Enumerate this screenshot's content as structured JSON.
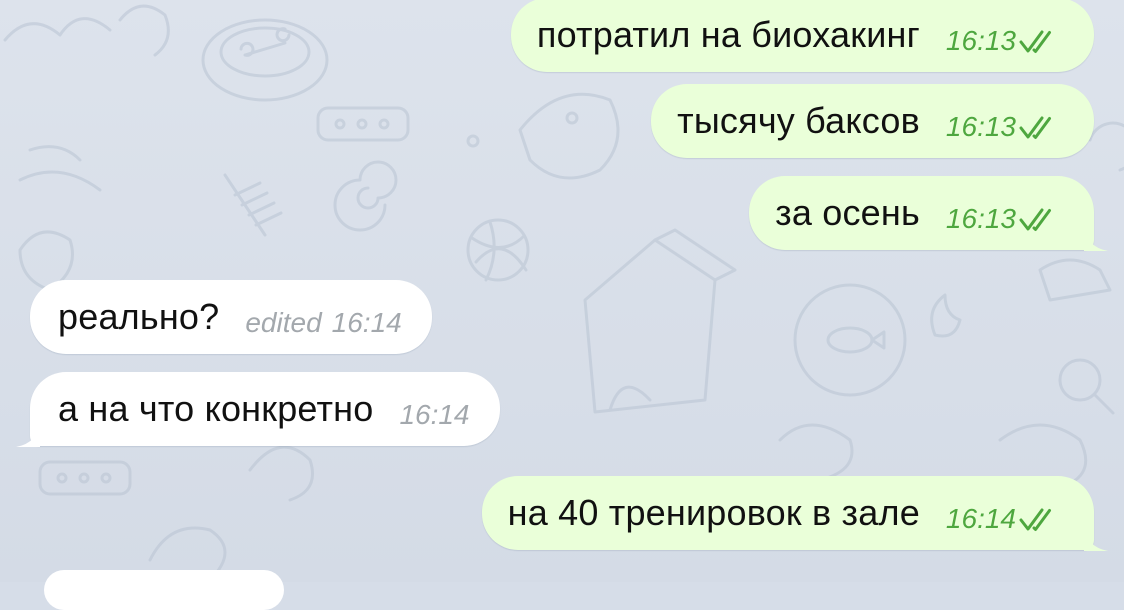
{
  "chat": {
    "background_color": "#d6dde8",
    "outgoing_bubble_color": "#eaffd9",
    "incoming_bubble_color": "#ffffff",
    "time_color_outgoing": "#4ea73f",
    "time_color_incoming": "#a3a8ad",
    "messages": [
      {
        "direction": "outgoing",
        "text": "потратил на биохакинг",
        "time": "16:13",
        "status": "read-double-check-icon"
      },
      {
        "direction": "outgoing",
        "text": "тысячу баксов",
        "time": "16:13",
        "status": "read-double-check-icon"
      },
      {
        "direction": "outgoing",
        "text": "за осень",
        "time": "16:13",
        "status": "read-double-check-icon"
      },
      {
        "direction": "incoming",
        "text": "реально?",
        "edited_label": "edited",
        "time": "16:14"
      },
      {
        "direction": "incoming",
        "text": "а на что конкретно",
        "time": "16:14"
      },
      {
        "direction": "outgoing",
        "text": "на 40 тренировок в зале",
        "time": "16:14",
        "status": "read-double-check-icon"
      }
    ]
  }
}
